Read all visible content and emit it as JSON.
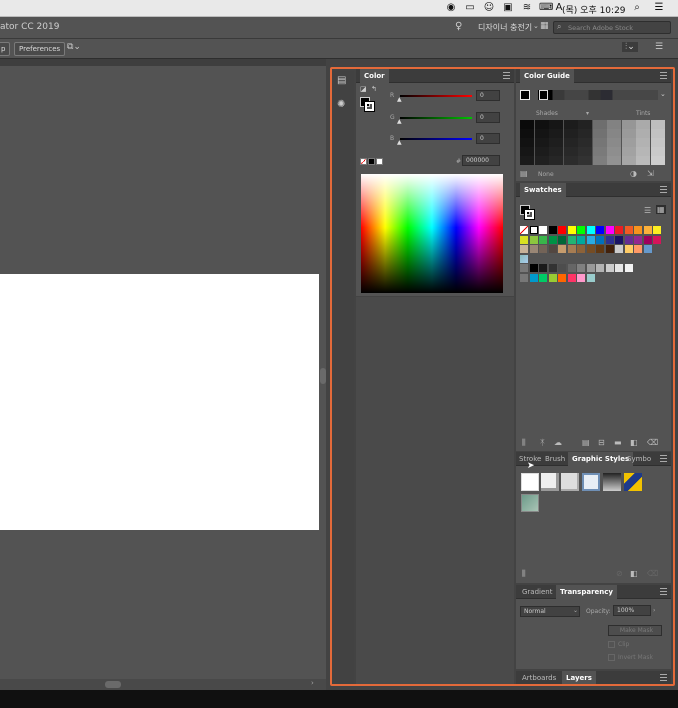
{
  "menubar": {
    "clock": "(목) 오후 10:29"
  },
  "titlebar": {
    "title": "ator CC 2019",
    "workspace": "디자이너 충전기",
    "search_placeholder": "Search Adobe Stock"
  },
  "ctrlbar": {
    "snap_button": "p",
    "preferences_button": "Preferences"
  },
  "color_panel": {
    "tab": "Color",
    "r_label": "R",
    "g_label": "G",
    "b_label": "B",
    "r_value": "0",
    "g_value": "0",
    "b_value": "0",
    "hex_label": "#",
    "hex_value": "000000",
    "colors": {
      "red": "#ff0000",
      "green": "#00c400",
      "blue": "#0000ff"
    }
  },
  "color_guide_panel": {
    "tab": "Color Guide",
    "shades_label": "Shades",
    "tints_label": "Tints",
    "none_label": "None"
  },
  "swatches_panel": {
    "tab": "Swatches",
    "row1": [
      "#ffffff",
      "#000000",
      "#ff0000",
      "#ffff00",
      "#00ff00",
      "#00ffff",
      "#0000ff",
      "#ff00ff",
      "#ed1c24",
      "#f15a24",
      "#f7931e",
      "#fbb03b",
      "#fcee21"
    ],
    "row2": [
      "#d9e021",
      "#8cc63f",
      "#39b54a",
      "#009245",
      "#006837",
      "#22b573",
      "#00a99d",
      "#29abe2",
      "#0071bc",
      "#2e3192",
      "#1b1464",
      "#662d91",
      "#93278f",
      "#9e005d",
      "#d4145a"
    ],
    "row3": [
      "#c7b299",
      "#998675",
      "#736357",
      "#534741",
      "#c69c6d",
      "#a67c52",
      "#8c6239",
      "#754c24",
      "#603813",
      "#42210b",
      "#cccccc",
      "#ffcc66",
      "#ff9966",
      "#6699cc"
    ],
    "row5": [
      "#000000",
      "#1a1a1a",
      "#333333",
      "#4d4d4d",
      "#666666",
      "#808080",
      "#999999",
      "#b3b3b3",
      "#cccccc",
      "#e6e6e6",
      "#f2f2f2"
    ],
    "row6": [
      "#0099cc",
      "#00cc66",
      "#99cc33",
      "#ff6600",
      "#ff3366",
      "#ff99cc",
      "#99cccc"
    ]
  },
  "graphic_styles_panel": {
    "tabs": [
      "Stroke",
      "Brush",
      "Graphic Styles",
      "Symbo"
    ]
  },
  "transparency_panel": {
    "tabs": [
      "Gradient",
      "Transparency"
    ],
    "blend_mode": "Normal",
    "opacity_label": "Opacity:",
    "opacity_value": "100%",
    "make_mask": "Make Mask",
    "clip": "Clip",
    "invert_mask": "Invert Mask"
  },
  "bottom_tabs": [
    "Artboards",
    "Layers"
  ]
}
